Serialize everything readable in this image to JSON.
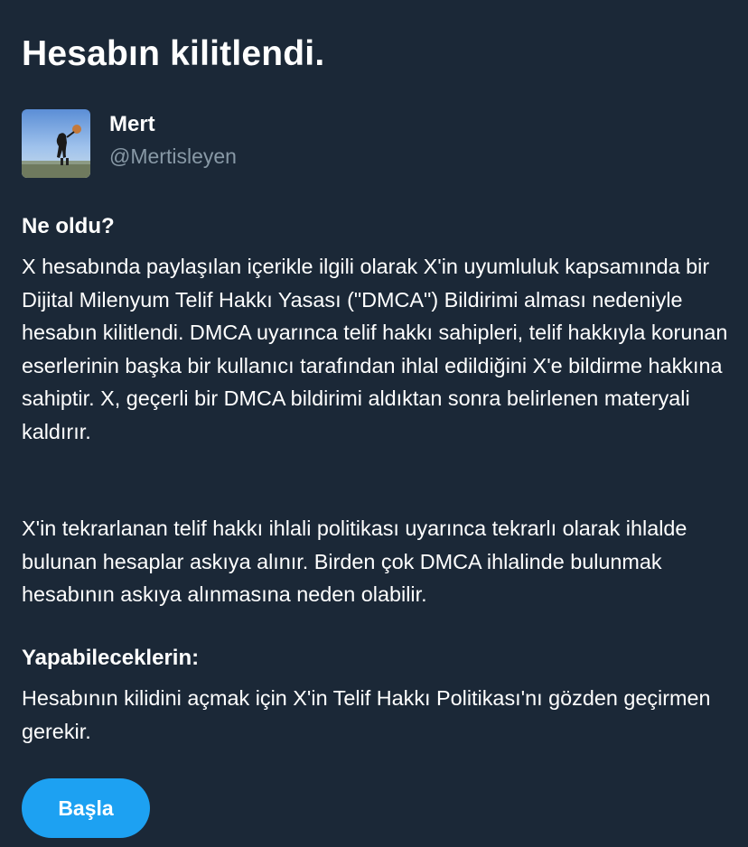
{
  "title": "Hesabın kilitlendi.",
  "account": {
    "display_name": "Mert",
    "handle": "@Mertisleyen"
  },
  "what_happened": {
    "heading": "Ne oldu?",
    "paragraph1": "X hesabında paylaşılan içerikle ilgili olarak X'in uyumluluk kapsamında bir Dijital Milenyum Telif Hakkı Yasası (\"DMCA\") Bildirimi alması nedeniyle hesabın kilitlendi. DMCA uyarınca telif hakkı sahipleri, telif hakkıyla korunan eserlerinin başka bir kullanıcı tarafından ihlal edildiğini X'e bildirme hakkına sahiptir. X, geçerli bir DMCA bildirimi aldıktan sonra belirlenen materyali kaldırır.",
    "paragraph2": "X'in tekrarlanan telif hakkı ihlali politikası uyarınca tekrarlı olarak ihlalde bulunan hesaplar askıya alınır. Birden çok DMCA ihlalinde bulunmak hesabının askıya alınmasına neden olabilir."
  },
  "what_you_can_do": {
    "heading": "Yapabileceklerin:",
    "paragraph": "Hesabının kilidini açmak için X'in Telif Hakkı Politikası'nı gözden geçirmen gerekir."
  },
  "start_button_label": "Başla",
  "colors": {
    "background": "#1b2837",
    "text": "#ffffff",
    "muted_text": "#8899a6",
    "accent": "#1da1f2"
  }
}
